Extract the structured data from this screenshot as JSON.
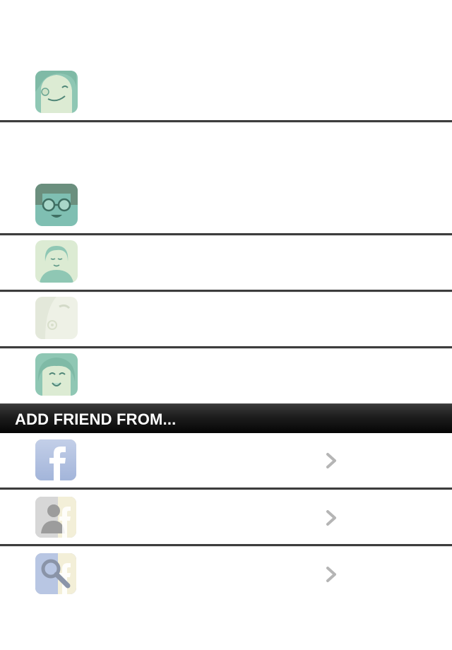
{
  "friends": [
    {
      "avatar": "smiling-man-avatar-icon"
    },
    {
      "avatar": "glasses-man-avatar-icon"
    },
    {
      "avatar": "short-hair-woman-avatar-icon"
    },
    {
      "avatar": "faded-man-avatar-icon"
    },
    {
      "avatar": "smiling-woman-avatar-icon"
    }
  ],
  "add_friend_section": {
    "header": "ADD FRIEND FROM...",
    "sources": [
      {
        "icon": "facebook-icon"
      },
      {
        "icon": "facebook-contacts-icon"
      },
      {
        "icon": "facebook-search-icon"
      }
    ]
  },
  "colors": {
    "avatar_teal": "#8fc7b4",
    "avatar_cream": "#dcebd3",
    "separator": "#3d3d3d",
    "header_bg": "#111111",
    "chevron": "#b5b5b5",
    "facebook_blue": "#a9b9dc"
  }
}
